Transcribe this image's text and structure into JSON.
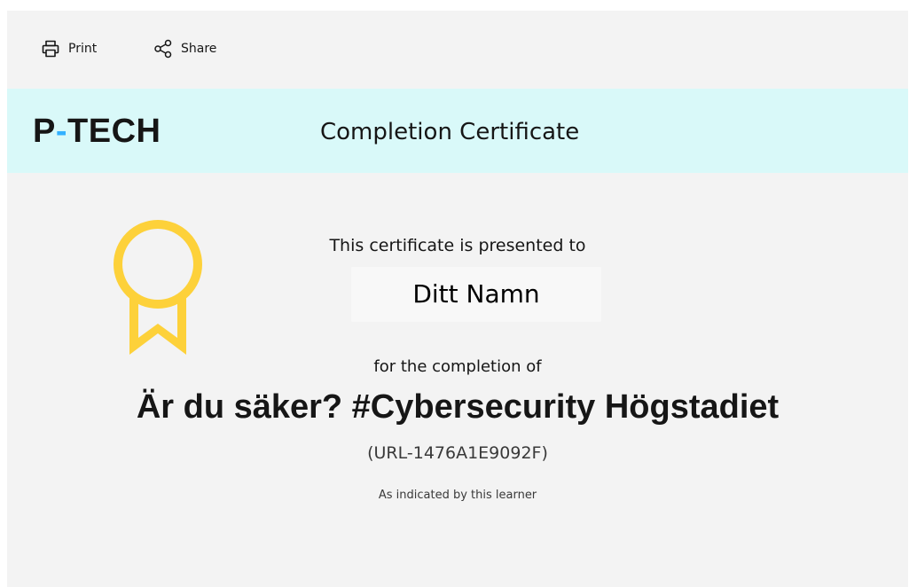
{
  "toolbar": {
    "print_label": "Print",
    "print_icon": "printer-icon",
    "share_label": "Share",
    "share_icon": "share-icon"
  },
  "banner": {
    "logo_part1": "P",
    "logo_dash": "-",
    "logo_part2": "TECH",
    "title": "Completion Certificate"
  },
  "certificate": {
    "badge_icon": "award-ribbon-icon",
    "presented_to": "This certificate is presented to",
    "recipient_name": "Ditt Namn",
    "for_completion": "for the completion of",
    "course_title": "Är du säker? #Cybersecurity Högstadiet",
    "certificate_id": "(URL-1476A1E9092F)",
    "note": "As indicated by this learner"
  },
  "colors": {
    "page_background": "#f3f3f3",
    "banner_background": "#d9f9f9",
    "logo_dash": "#33b1ff",
    "badge": "#fdd13a",
    "name_box": "#f8f8f8"
  }
}
